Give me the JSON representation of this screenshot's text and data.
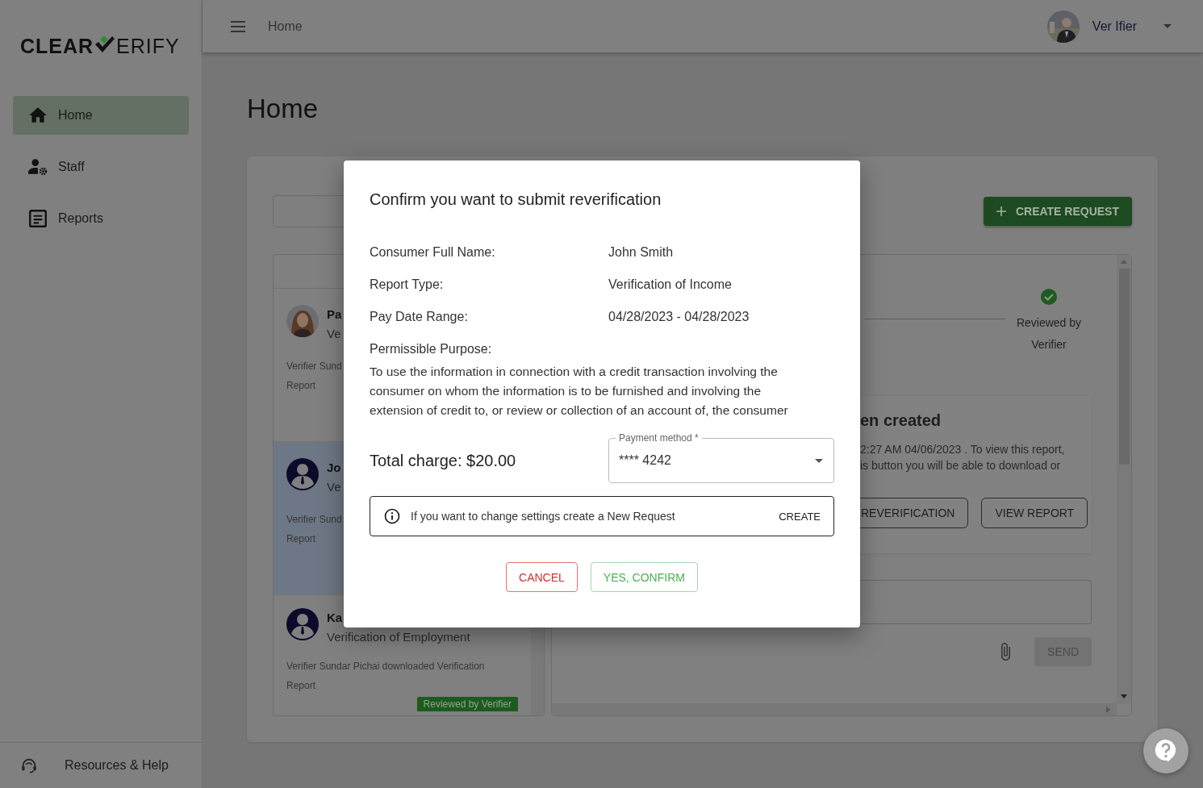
{
  "sidebar": {
    "logo": {
      "left": "CLEAR",
      "right": "ERIFY"
    },
    "items": [
      {
        "label": "Home",
        "selected": true
      },
      {
        "label": "Staff",
        "selected": false
      },
      {
        "label": "Reports",
        "selected": false
      }
    ],
    "footer": {
      "label": "Resources & Help"
    }
  },
  "header": {
    "breadcrumb": "Home",
    "user": {
      "name": "Ver Ifier"
    }
  },
  "page_title": "Home",
  "toolbar": {
    "create_button": "CREATE REQUEST"
  },
  "request_list": [
    {
      "title": "Pa",
      "subtitle": "Ve",
      "kind": "picture",
      "selected": false,
      "activity_lines": [
        "Verifier Sund",
        "Report"
      ]
    },
    {
      "title": "Jo",
      "subtitle": "Ve",
      "kind": "default",
      "selected": true,
      "activity_lines": [
        "Verifier Sund",
        "Report"
      ]
    },
    {
      "title": "Ka",
      "subtitle": "Verification of Employment",
      "kind": "default",
      "selected": false,
      "activity_lines": [
        "Verifier Sundar Pichai downloaded Verification",
        "Report"
      ],
      "badge": "Reviewed by Verifier"
    }
  ],
  "detail": {
    "step": {
      "label": "Reviewed by Verifier",
      "done": true
    },
    "notice": {
      "title": "en created",
      "lines": [
        "2:27 AM 04/06/2023 . To view this report,",
        "is button you will be able to download or"
      ],
      "buttons": [
        "REVERIFICATION",
        "VIEW REPORT"
      ]
    },
    "message": {
      "send": "SEND",
      "send_disabled": true
    }
  },
  "dialog": {
    "title": "Confirm you want to submit reverification",
    "fields": [
      {
        "label": "Consumer Full Name:",
        "value": "John Smith"
      },
      {
        "label": "Report Type:",
        "value": "Verification of Income"
      },
      {
        "label": "Pay Date Range:",
        "value": "04/28/2023 - 04/28/2023"
      }
    ],
    "purpose": {
      "label": "Permissible Purpose:",
      "text": "To use the information in connection with a credit transaction involving the consumer on whom the information is to be furnished and involving the extension of credit to, or review or collection of an account of, the consumer"
    },
    "total": "Total charge: $20.00",
    "payment": {
      "label": "Payment method *",
      "value": "**** 4242"
    },
    "info": {
      "text": "If you want to change settings create a New Request",
      "action": "CREATE"
    },
    "buttons": [
      {
        "label": "CANCEL",
        "kind": "cancel"
      },
      {
        "label": "YES, CONFIRM",
        "kind": "confirm"
      }
    ]
  }
}
